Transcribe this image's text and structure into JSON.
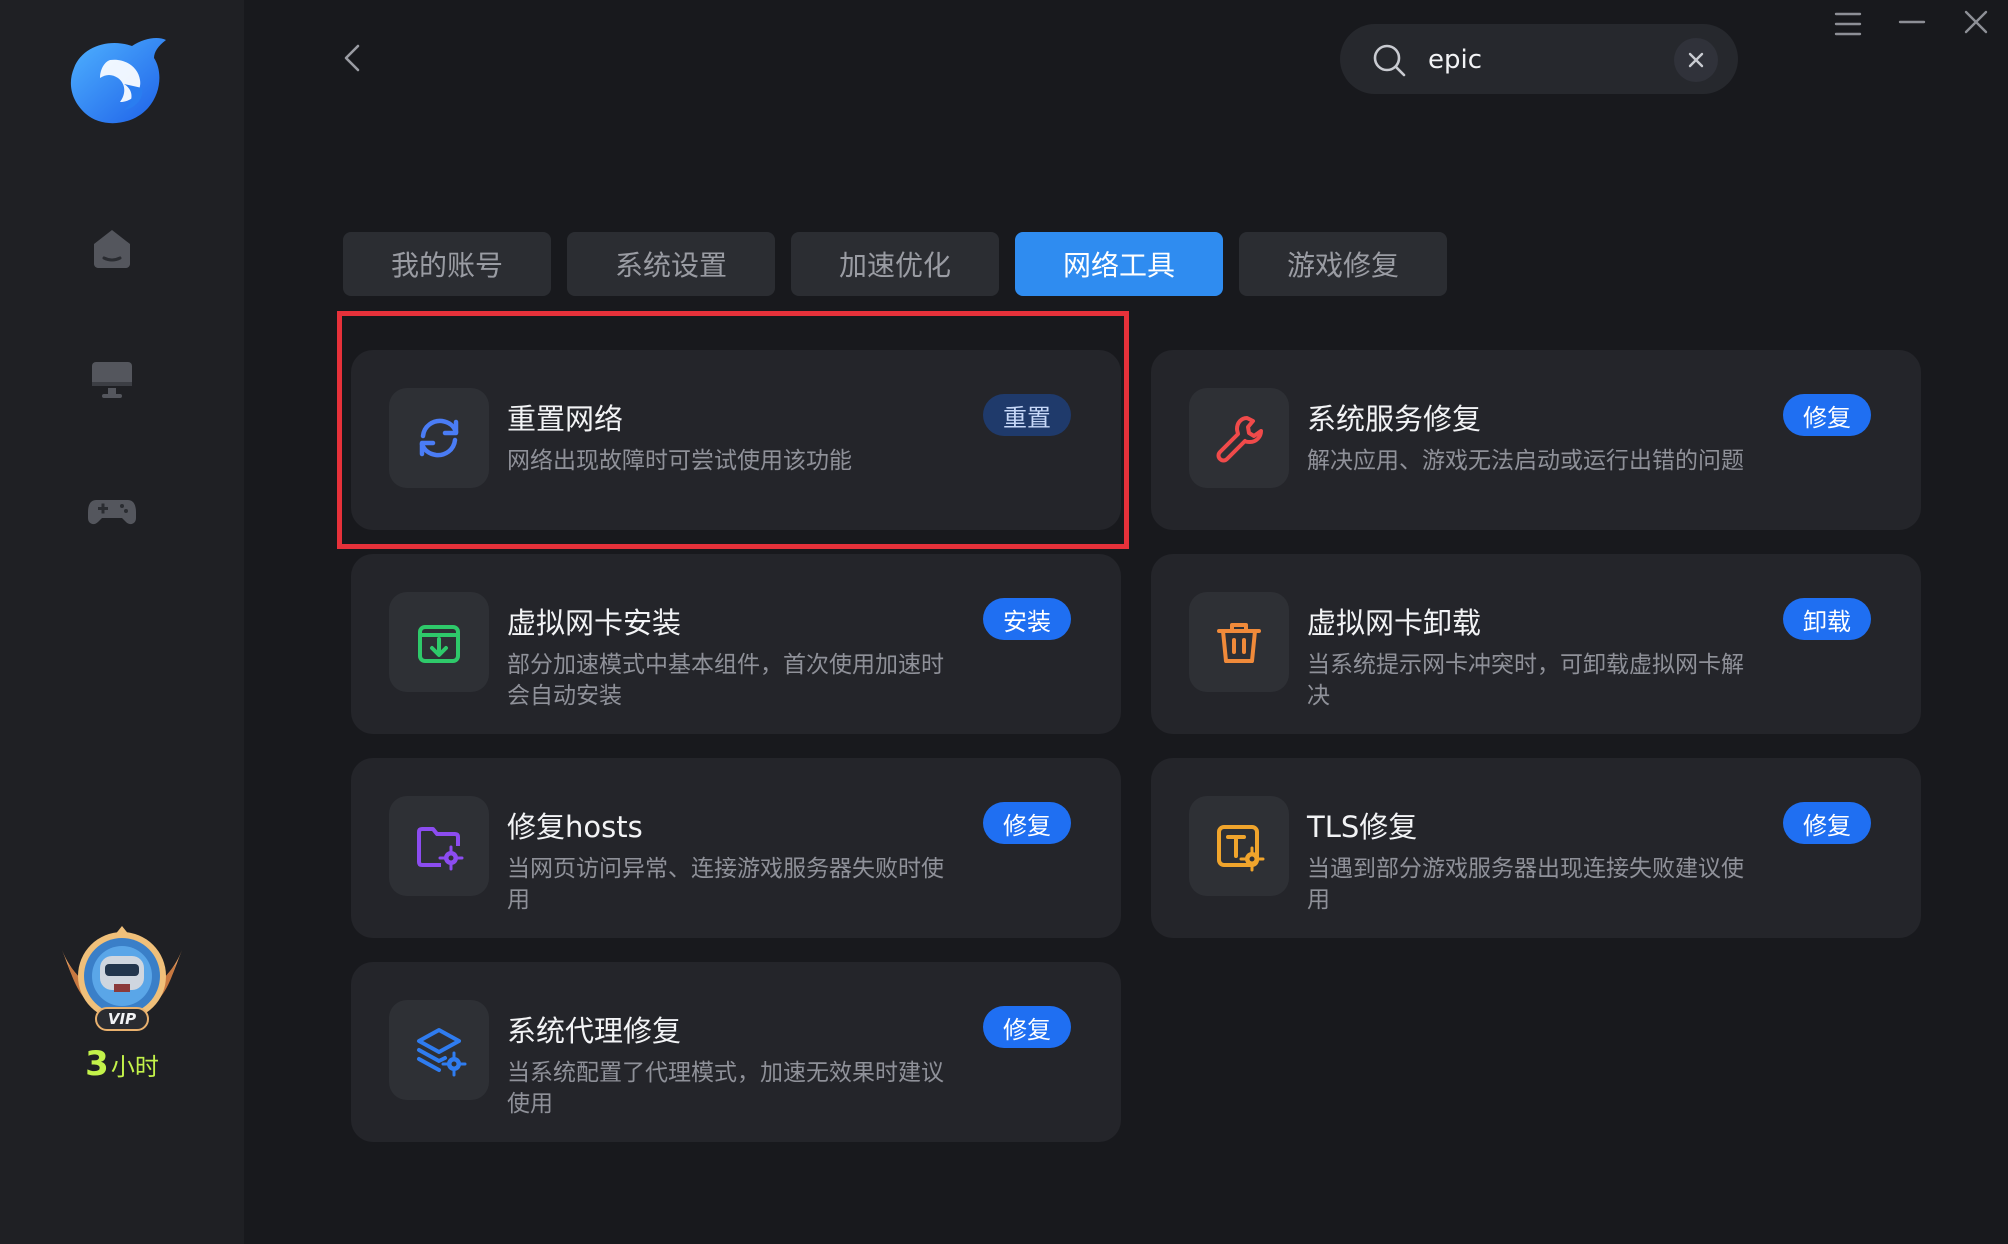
{
  "header": {
    "search": {
      "value": "epic",
      "placeholder": ""
    }
  },
  "sidebar": {
    "nav": [
      {
        "name": "home-icon"
      },
      {
        "name": "monitor-icon"
      },
      {
        "name": "gamepad-icon"
      }
    ],
    "vip": {
      "label": "VIP",
      "hours_number": "3",
      "hours_unit": "小时"
    }
  },
  "tabs": [
    {
      "label": "我的账号",
      "active": false
    },
    {
      "label": "系统设置",
      "active": false
    },
    {
      "label": "加速优化",
      "active": false
    },
    {
      "label": "网络工具",
      "active": true
    },
    {
      "label": "游戏修复",
      "active": false
    }
  ],
  "tools": [
    {
      "icon": "refresh-icon",
      "title": "重置网络",
      "desc": "网络出现故障时可尝试使用该功能",
      "action": "重置",
      "highlighted": true
    },
    {
      "icon": "wrench-icon",
      "title": "系统服务修复",
      "desc": "解决应用、游戏无法启动或运行出错的问题",
      "action": "修复"
    },
    {
      "icon": "install-box-icon",
      "title": "虚拟网卡安装",
      "desc": "部分加速模式中基本组件，首次使用加速时会自动安装",
      "action": "安装"
    },
    {
      "icon": "trash-icon",
      "title": "虚拟网卡卸载",
      "desc": "当系统提示网卡冲突时，可卸载虚拟网卡解决",
      "action": "卸载"
    },
    {
      "icon": "folder-gear-icon",
      "title": "修复hosts",
      "desc": "当网页访问异常、连接游戏服务器失败时使用",
      "action": "修复"
    },
    {
      "icon": "tls-gear-icon",
      "title": "TLS修复",
      "desc": "当遇到部分游戏服务器出现连接失败建议使用",
      "action": "修复"
    },
    {
      "icon": "layers-gear-icon",
      "title": "系统代理修复",
      "desc": "当系统配置了代理模式，加速无效果时建议使用",
      "action": "修复"
    }
  ],
  "colors": {
    "accent": "#2f8cf0",
    "highlight_border": "#e6313a",
    "vip_hours": "#c3f24a"
  }
}
